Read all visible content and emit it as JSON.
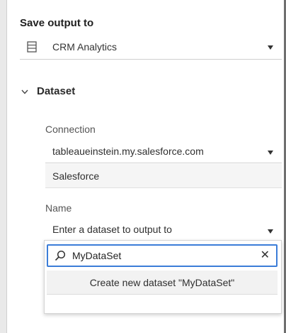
{
  "output": {
    "title": "Save output to",
    "selected": "CRM Analytics",
    "icon": "table-icon"
  },
  "dataset": {
    "header": "Dataset",
    "connection": {
      "label": "Connection",
      "value": "tableaueinstein.my.salesforce.com",
      "type": "Salesforce"
    },
    "name": {
      "label": "Name",
      "placeholder": "Enter a dataset to output to",
      "search_value": "MyDataSet",
      "create_option": "Create new dataset \"MyDataSet\""
    }
  },
  "colors": {
    "focus_border": "#3b7dd8",
    "spellcheck_underline": "#d9534f"
  }
}
